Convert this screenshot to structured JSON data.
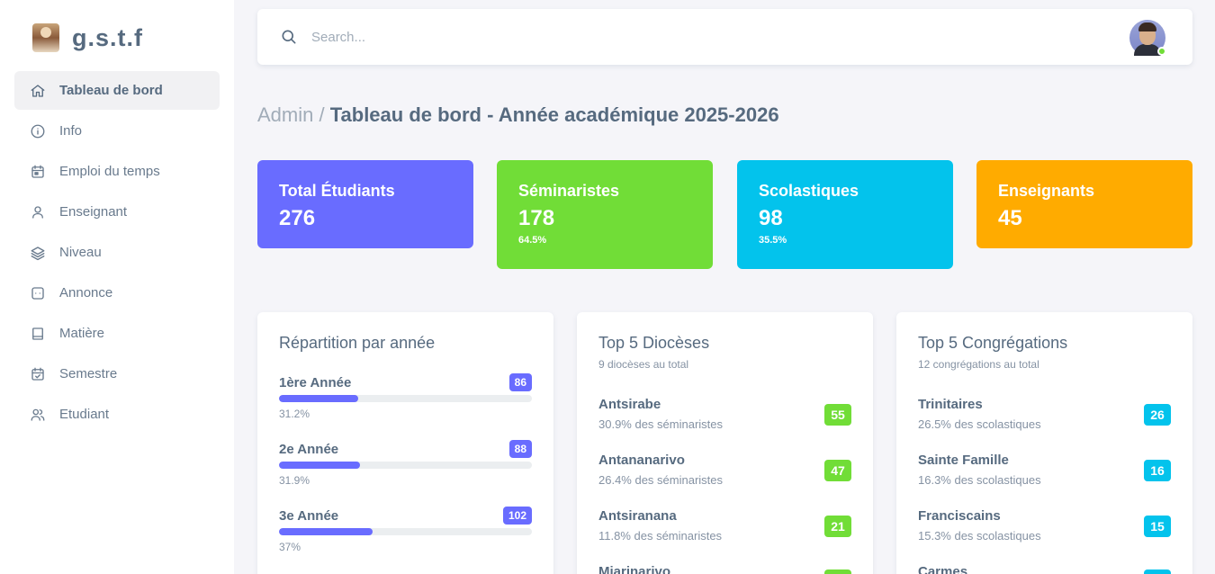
{
  "brand": {
    "name": "g.s.t.f"
  },
  "sidebar": {
    "items": [
      {
        "label": "Tableau de bord",
        "icon": "home-icon",
        "active": true
      },
      {
        "label": "Info",
        "icon": "info-icon"
      },
      {
        "label": "Emploi du temps",
        "icon": "calendar-icon"
      },
      {
        "label": "Enseignant",
        "icon": "user-icon"
      },
      {
        "label": "Niveau",
        "icon": "layers-icon"
      },
      {
        "label": "Annonce",
        "icon": "chat-icon"
      },
      {
        "label": "Matière",
        "icon": "book-icon"
      },
      {
        "label": "Semestre",
        "icon": "calendar-check-icon"
      },
      {
        "label": "Etudiant",
        "icon": "users-icon"
      }
    ]
  },
  "navbar": {
    "search_placeholder": "Search..."
  },
  "header": {
    "crumb": "Admin /",
    "title": "Tableau de bord - Année académique 2025-2026"
  },
  "stats": [
    {
      "label": "Total Étudiants",
      "value": "276",
      "pct": "",
      "color": "#696cff"
    },
    {
      "label": "Séminaristes",
      "value": "178",
      "pct": "64.5%",
      "color": "#71dd37"
    },
    {
      "label": "Scolastiques",
      "value": "98",
      "pct": "35.5%",
      "color": "#03c3ec"
    },
    {
      "label": "Enseignants",
      "value": "45",
      "pct": "",
      "color": "#ffab00"
    }
  ],
  "years": {
    "title": "Répartition par année",
    "items": [
      {
        "label": "1ère Année",
        "count": "86",
        "pct": "31.2%",
        "fraction": 0.312
      },
      {
        "label": "2e Année",
        "count": "88",
        "pct": "31.9%",
        "fraction": 0.319
      },
      {
        "label": "3e Année",
        "count": "102",
        "pct": "37%",
        "fraction": 0.37
      }
    ]
  },
  "dioceses": {
    "title": "Top 5 Diocèses",
    "subtitle": "9 diocèses au total",
    "color": "#71dd37",
    "items": [
      {
        "name": "Antsirabe",
        "sub": "30.9% des séminaristes",
        "count": "55"
      },
      {
        "name": "Antananarivo",
        "sub": "26.4% des séminaristes",
        "count": "47"
      },
      {
        "name": "Antsiranana",
        "sub": "11.8% des séminaristes",
        "count": "21"
      },
      {
        "name": "Miarinarivo",
        "sub": "",
        "count": ""
      }
    ]
  },
  "congregations": {
    "title": "Top 5 Congrégations",
    "subtitle": "12 congrégations au total",
    "color": "#03c3ec",
    "items": [
      {
        "name": "Trinitaires",
        "sub": "26.5% des scolastiques",
        "count": "26"
      },
      {
        "name": "Sainte Famille",
        "sub": "16.3% des scolastiques",
        "count": "16"
      },
      {
        "name": "Franciscains",
        "sub": "15.3% des scolastiques",
        "count": "15"
      },
      {
        "name": "Carmes",
        "sub": "",
        "count": ""
      }
    ]
  }
}
